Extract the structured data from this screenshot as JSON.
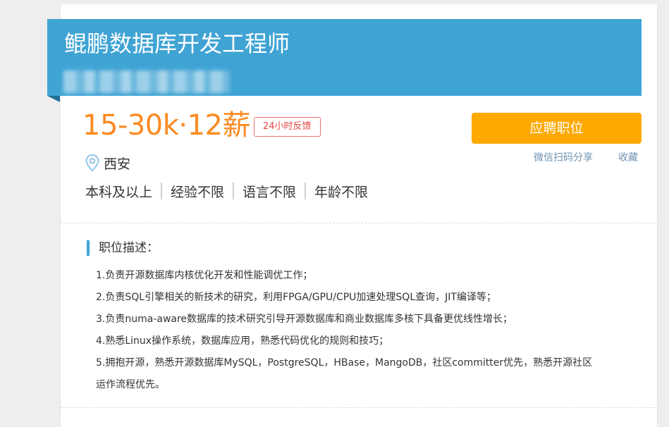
{
  "job": {
    "title": "鲲鹏数据库开发工程师",
    "salary": "15-30k·12薪",
    "feedback_badge": "24小时反馈",
    "location": "西安",
    "requirements": [
      "本科及以上",
      "经验不限",
      "语言不限",
      "年龄不限"
    ]
  },
  "actions": {
    "apply_label": "应聘职位",
    "share_label": "微信扫码分享",
    "collect_label": "收藏"
  },
  "description": {
    "title": "职位描述：",
    "lines": [
      "1.负责开源数据库内核优化开发和性能调优工作；",
      "2.负责SQL引擎相关的新技术的研究，利用FPGA/GPU/CPU加速处理SQL查询，JIT编译等；",
      "3.负责numa-aware数据库的技术研究引导开源数据库和商业数据库多核下具备更优线性增长；",
      "4.熟悉Linux操作系统，数据库应用，熟悉代码优化的规则和技巧；",
      "5.拥抱开源，熟悉开源数据库MySQL，PostgreSQL，HBase，MangoDB，社区committer优先，熟悉开源社区",
      "运作流程优先。"
    ]
  },
  "colors": {
    "banner": "#3fa3d4",
    "salary": "#fb8a21",
    "apply_button": "#fea901",
    "badge": "#e64545",
    "link": "#6e93b3"
  },
  "icons": {
    "location": "map-pin-icon"
  }
}
